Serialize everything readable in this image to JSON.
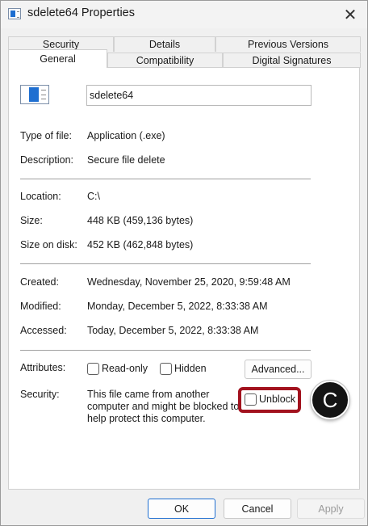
{
  "window": {
    "title": "sdelete64 Properties"
  },
  "tabs": {
    "row1": [
      "Security",
      "Details",
      "Previous Versions"
    ],
    "row2": [
      "General",
      "Compatibility",
      "Digital Signatures"
    ],
    "active": "General"
  },
  "general": {
    "file_name": "sdelete64",
    "type_label": "Type of file:",
    "type_value": "Application (.exe)",
    "description_label": "Description:",
    "description_value": "Secure file delete",
    "location_label": "Location:",
    "location_value": "C:\\",
    "size_label": "Size:",
    "size_value": "448 KB (459,136 bytes)",
    "size_on_disk_label": "Size on disk:",
    "size_on_disk_value": "452 KB (462,848 bytes)",
    "created_label": "Created:",
    "created_value": "Wednesday, November 25, 2020, 9:59:48 AM",
    "modified_label": "Modified:",
    "modified_value": "Monday, December 5, 2022, 8:33:38 AM",
    "accessed_label": "Accessed:",
    "accessed_value": "Today, December 5, 2022, 8:33:38 AM",
    "attributes_label": "Attributes:",
    "read_only_label": "Read-only",
    "hidden_label": "Hidden",
    "advanced_label": "Advanced...",
    "security_label": "Security:",
    "security_text_1": "This file came from another",
    "security_text_2": "computer and might be blocked to",
    "security_text_3": "help protect this computer.",
    "unblock_label": "Unblock"
  },
  "callout": {
    "letter": "C"
  },
  "footer": {
    "ok_label": "OK",
    "cancel_label": "Cancel",
    "apply_label": "Apply"
  },
  "colors": {
    "highlight": "#a2121e",
    "accent": "#1f6fd1",
    "callout_bg": "#141414"
  }
}
